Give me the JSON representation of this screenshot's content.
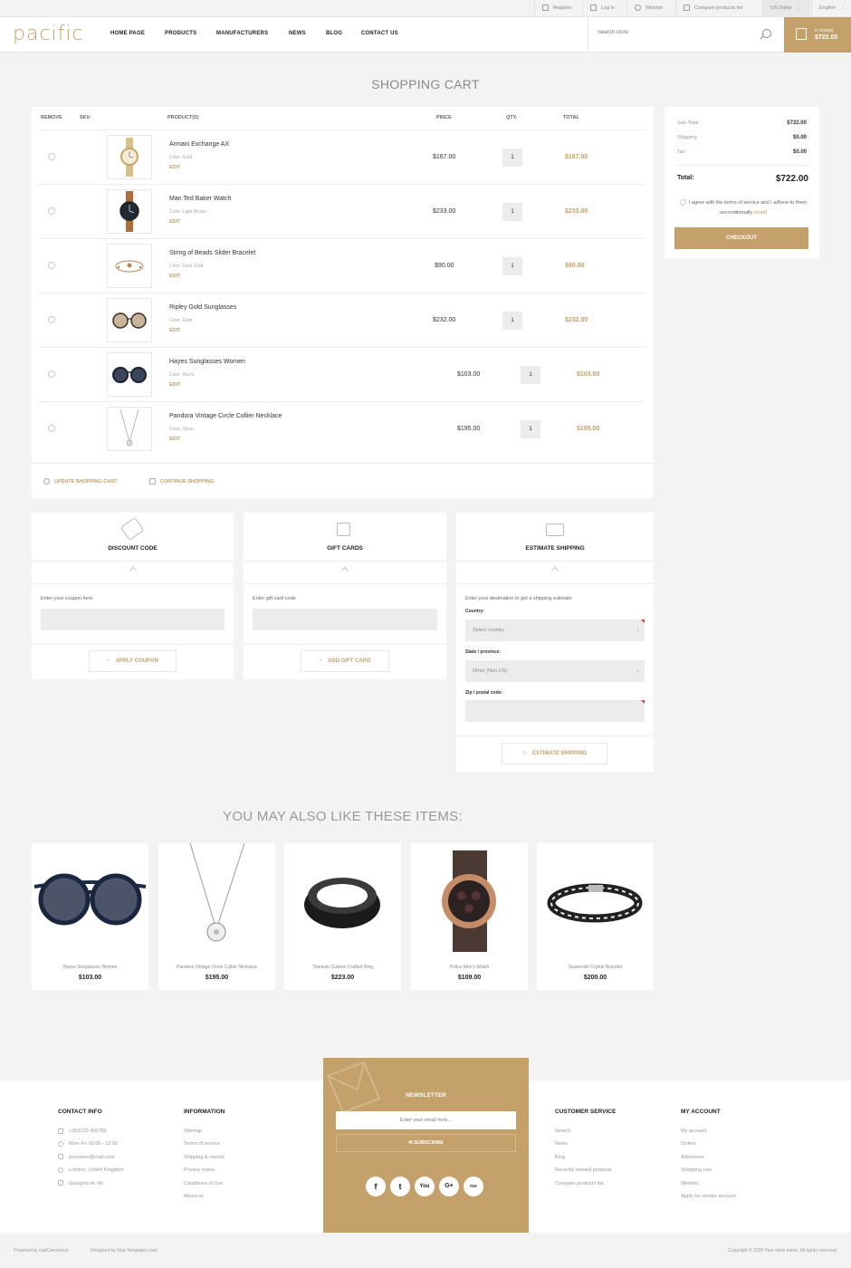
{
  "topbar": {
    "register": "Register",
    "login": "Log in",
    "wishlist": "Wishlist",
    "compare": "Compare products list",
    "currency": "US Dollar",
    "language": "English"
  },
  "header": {
    "logo": "pacific",
    "nav": [
      "HOME PAGE",
      "PRODUCTS",
      "MANUFACTURERS",
      "NEWS",
      "BLOG",
      "CONTACT US"
    ],
    "search_placeholder": "Search store",
    "cart_items": "6 ITEM(S)",
    "cart_amount": "$722.00"
  },
  "page_title": "SHOPPING CART",
  "cart": {
    "headers": {
      "remove": "REMOVE",
      "sku": "SKU",
      "product": "PRODUCT(S)",
      "price": "PRICE",
      "qty": "QTY.",
      "total": "TOTAL"
    },
    "rows": [
      {
        "name": "Armani Exchange AX",
        "attr": "Color: Gold",
        "edit": "EDIT",
        "price": "$167.00",
        "qty": "1",
        "total": "$167.00"
      },
      {
        "name": "Man Ted Baker Watch",
        "attr": "Color: Light Brown",
        "edit": "EDIT",
        "price": "$233.00",
        "qty": "1",
        "total": "$233.00"
      },
      {
        "name": "String of Beads Slider Bracelet",
        "attr": "Color: Dark Gold",
        "edit": "EDIT",
        "price": "$90.00",
        "qty": "1",
        "total": "$90.00"
      },
      {
        "name": "Ripley Gold Sunglasses",
        "attr": "Color: Gold",
        "edit": "EDIT",
        "price": "$232.00",
        "qty": "1",
        "total": "$232.00"
      },
      {
        "name": "Hayes Sunglasses Women",
        "attr": "Color: Black",
        "edit": "EDIT",
        "price": "$103.00",
        "qty": "1",
        "total": "$103.00"
      },
      {
        "name": "Pandora Vintage Circle Collier Necklace",
        "attr": "Color: Silver",
        "edit": "EDIT",
        "price": "$195.00",
        "qty": "1",
        "total": "$195.00"
      }
    ],
    "update": "UPDATE SHOPPING CART",
    "continue": "CONTINUE SHOPPING"
  },
  "totals": {
    "subtotal_label": "Sub-Total:",
    "subtotal": "$722.00",
    "shipping_label": "Shipping:",
    "shipping": "$0.00",
    "tax_label": "Tax:",
    "tax": "$0.00",
    "total_label": "Total:",
    "total": "$722.00",
    "terms": "I agree with the terms of service and I adhere to them unconditionally",
    "terms_link": "(read)",
    "checkout": "CHECKOUT"
  },
  "discount": {
    "title": "DISCOUNT CODE",
    "label": "Enter your coupon here",
    "button": "APPLY COUPON"
  },
  "giftcard": {
    "title": "GIFT CARDS",
    "label": "Enter gift card code",
    "button": "ADD GIFT CARD"
  },
  "shipping": {
    "title": "ESTIMATE SHIPPING",
    "intro": "Enter your destination to get a shipping estimate",
    "country_label": "Country:",
    "country_value": "Select country",
    "state_label": "State / province:",
    "state_value": "Other (Non US)",
    "zip_label": "Zip / postal code:",
    "button": "ESTIMATE SHIPPING"
  },
  "related": {
    "title": "YOU MAY ALSO LIKE THESE ITEMS:",
    "items": [
      {
        "name": "Hayes Sunglasses Women",
        "price": "$103.00"
      },
      {
        "name": "Pandora Vintage Circle Collier Necklace",
        "price": "$195.00"
      },
      {
        "name": "Titanium Custom Crafted Ring",
        "price": "$223.00"
      },
      {
        "name": "Police Men's Watch",
        "price": "$109.00"
      },
      {
        "name": "Swarovski Crystal Bracelet",
        "price": "$200.00"
      }
    ]
  },
  "footer": {
    "contact": {
      "title": "CONTACT INFO",
      "items": [
        "+359123 456789",
        "Mon–Fri 10:00 - 19:00",
        "yourstore@mail.com",
        "London, United Kingdom",
        "Glasgow str. 45"
      ]
    },
    "information": {
      "title": "INFORMATION",
      "items": [
        "Sitemap",
        "Terms of service",
        "Shipping & returns",
        "Privacy notice",
        "Conditions of Use",
        "About us"
      ]
    },
    "newsletter": {
      "title": "NEWSLETTER",
      "placeholder": "Enter your email here...",
      "button": "SUBSCRIBE"
    },
    "customer": {
      "title": "CUSTOMER SERVICE",
      "items": [
        "Search",
        "News",
        "Blog",
        "Recently viewed products",
        "Compare products list"
      ]
    },
    "account": {
      "title": "MY ACCOUNT",
      "items": [
        "My account",
        "Orders",
        "Addresses",
        "Shopping cart",
        "Wishlist",
        "Apply for vendor account"
      ]
    },
    "social": [
      "f",
      "t",
      "You",
      "G+",
      "rss"
    ],
    "powered": "Powered by nopCommerce",
    "designed": "Designed by Nop-Templates.com",
    "copyright": "Copyright © 2020 Your store name. All rights reserved."
  }
}
